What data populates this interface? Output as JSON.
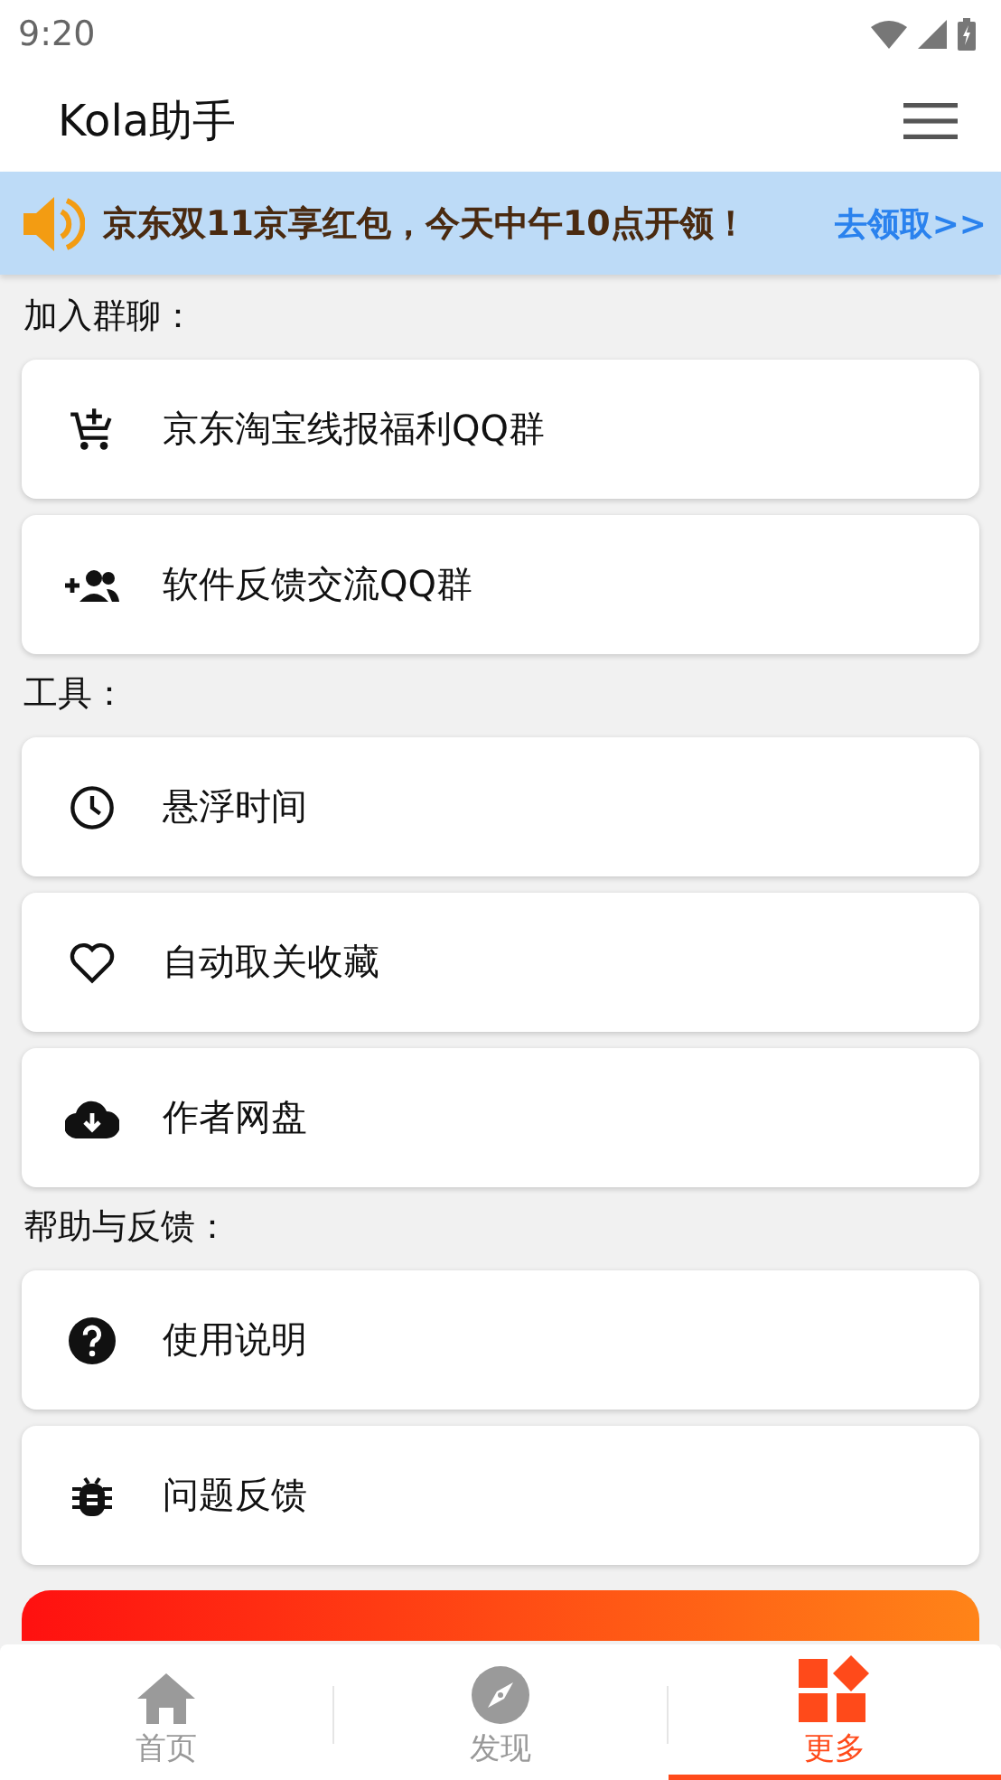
{
  "status_bar": {
    "time": "9:20"
  },
  "app_bar": {
    "title": "Kola助手"
  },
  "notice": {
    "text": "京东双11京享红包，今天中午10点开领！",
    "link": "去领取>>"
  },
  "sections": [
    {
      "title": "加入群聊：",
      "items": [
        {
          "label": "京东淘宝线报福利QQ群"
        },
        {
          "label": "软件反馈交流QQ群"
        }
      ]
    },
    {
      "title": "工具：",
      "items": [
        {
          "label": "悬浮时间"
        },
        {
          "label": "自动取关收藏"
        },
        {
          "label": "作者网盘"
        }
      ]
    },
    {
      "title": "帮助与反馈：",
      "items": [
        {
          "label": "使用说明"
        },
        {
          "label": "问题反馈"
        }
      ]
    }
  ],
  "tabs": [
    {
      "label": "首页",
      "selected": false
    },
    {
      "label": "发现",
      "selected": false
    },
    {
      "label": "更多",
      "selected": true
    }
  ]
}
